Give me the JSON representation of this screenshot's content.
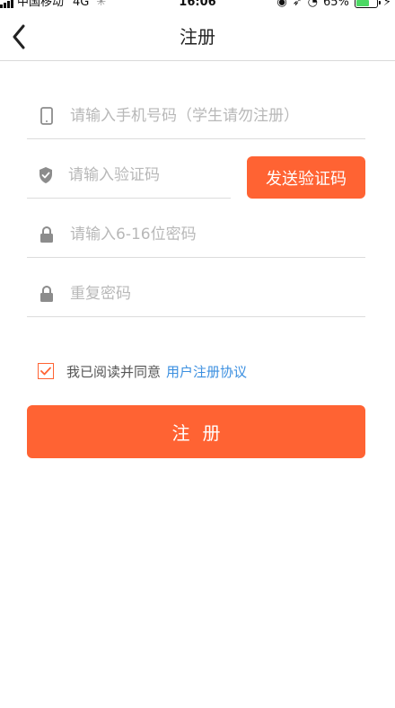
{
  "status_bar": {
    "carrier": "中国移动",
    "network": "4G",
    "time": "16:06",
    "battery_percent": "65%",
    "battery_level": 0.65,
    "battery_color": "#4cd964"
  },
  "nav": {
    "title": "注册",
    "back_icon": "chevron-left-icon"
  },
  "form": {
    "phone": {
      "value": "",
      "placeholder": "请输入手机号码（学生请勿注册）",
      "icon": "phone-icon"
    },
    "code": {
      "value": "",
      "placeholder": "请输入验证码",
      "icon": "shield-check-icon"
    },
    "send_code_label": "发送验证码",
    "password": {
      "value": "",
      "placeholder": "请输入6-16位密码",
      "icon": "lock-icon"
    },
    "confirm_password": {
      "value": "",
      "placeholder": "重复密码",
      "icon": "lock-icon"
    }
  },
  "agreement": {
    "checked": true,
    "text": "我已阅读并同意",
    "link_text": "用户注册协议"
  },
  "register_label": "注册",
  "colors": {
    "accent": "#ff6333",
    "link": "#3b8fe0",
    "placeholder": "#b8b8b8",
    "icon": "#8c8c8c"
  }
}
